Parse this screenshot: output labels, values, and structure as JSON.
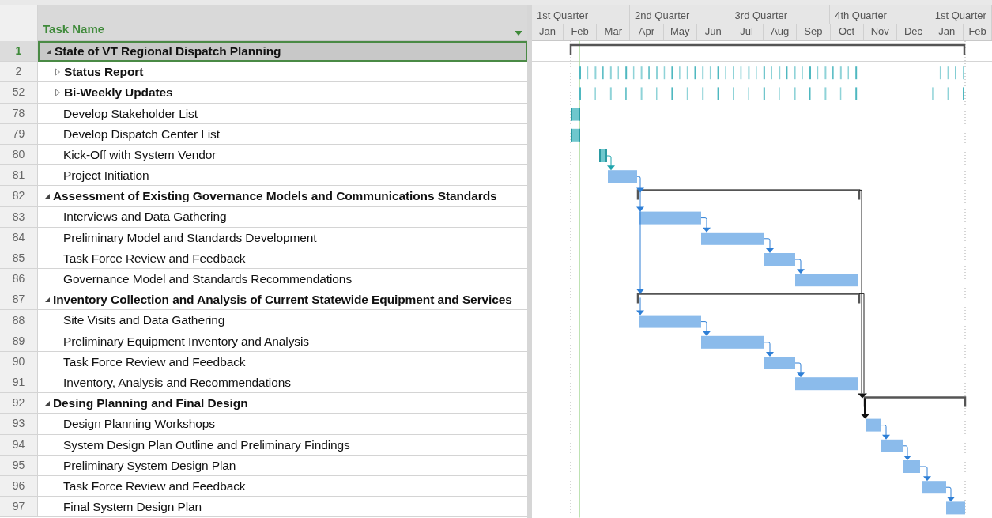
{
  "table": {
    "column": "Task Name"
  },
  "timescale": {
    "quarters": [
      "1st Quarter",
      "2nd Quarter",
      "3rd Quarter",
      "4th Quarter",
      "1st Quarter"
    ],
    "months": [
      "Jan",
      "Feb",
      "Mar",
      "Apr",
      "May",
      "Jun",
      "Jul",
      "Aug",
      "Sep",
      "Oct",
      "Nov",
      "Dec",
      "Jan",
      "Feb"
    ]
  },
  "rows": [
    {
      "id": "1",
      "name": "State of VT Regional Dispatch Planning",
      "kind": "summary",
      "expanded": true,
      "selected": true,
      "children": [
        {
          "id": "2",
          "name": "Status Report",
          "kind": "recurring",
          "expanded": false,
          "selected": false
        },
        {
          "id": "52",
          "name": "Bi-Weekly Updates",
          "kind": "recurring",
          "expanded": false,
          "selected": false
        },
        {
          "id": "78",
          "name": "Develop Stakeholder List",
          "kind": "complete",
          "selected": false
        },
        {
          "id": "79",
          "name": "Develop Dispatch Center List",
          "kind": "complete",
          "selected": false
        },
        {
          "id": "80",
          "name": "Kick-Off with System Vendor",
          "kind": "complete",
          "selected": false
        },
        {
          "id": "81",
          "name": "Project Initiation",
          "kind": "planned",
          "selected": false
        }
      ]
    },
    {
      "id": "82",
      "name": "Assessment of Existing Governance Models and Communications Standards",
      "kind": "summary",
      "expanded": true,
      "selected": false,
      "children": [
        {
          "id": "83",
          "name": "Interviews and Data Gathering",
          "kind": "planned",
          "selected": false
        },
        {
          "id": "84",
          "name": "Preliminary Model and Standards Development",
          "kind": "planned",
          "selected": false
        },
        {
          "id": "85",
          "name": "Task Force Review and Feedback",
          "kind": "planned",
          "selected": false
        },
        {
          "id": "86",
          "name": "Governance Model and Standards Recommendations",
          "kind": "planned",
          "selected": false
        }
      ]
    },
    {
      "id": "87",
      "name": "Inventory Collection and Analysis of Current Statewide Equipment and Services",
      "kind": "summary",
      "expanded": true,
      "selected": false,
      "children": [
        {
          "id": "88",
          "name": "Site Visits and Data Gathering",
          "kind": "planned",
          "selected": false
        },
        {
          "id": "89",
          "name": "Preliminary Equipment Inventory and Analysis",
          "kind": "planned",
          "selected": false
        },
        {
          "id": "90",
          "name": "Task Force Review and Feedback",
          "kind": "planned",
          "selected": false
        },
        {
          "id": "91",
          "name": "Inventory, Analysis and Recommendations",
          "kind": "planned",
          "selected": false
        }
      ]
    },
    {
      "id": "92",
      "name": "Desing Planning and Final Design",
      "kind": "summary",
      "expanded": true,
      "selected": false,
      "children": [
        {
          "id": "93",
          "name": "Design Planning Workshops",
          "kind": "planned",
          "selected": false
        },
        {
          "id": "94",
          "name": "System Design Plan Outline and Preliminary Findings",
          "kind": "planned",
          "selected": false
        },
        {
          "id": "95",
          "name": "Preliminary System Design Plan",
          "kind": "planned",
          "selected": false
        },
        {
          "id": "96",
          "name": "Task Force Review and Feedback",
          "kind": "planned",
          "selected": false
        },
        {
          "id": "97",
          "name": "Final System Design Plan",
          "kind": "planned",
          "selected": false
        }
      ]
    }
  ]
}
